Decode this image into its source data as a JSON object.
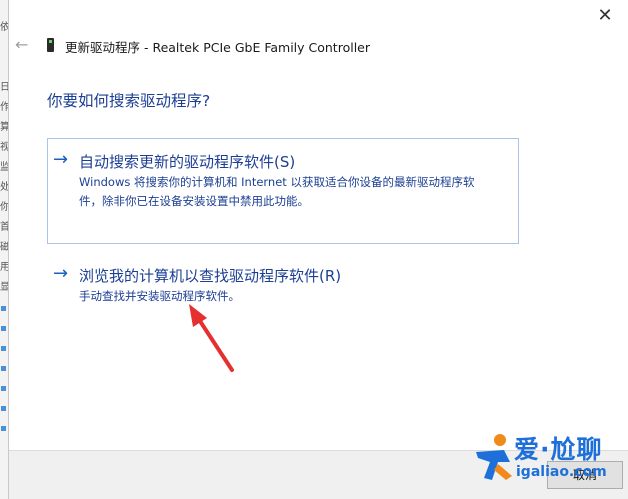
{
  "dialog": {
    "title": "更新驱动程序 - Realtek PCIe GbE Family Controller",
    "question": "你要如何搜索驱动程序?",
    "close_glyph": "✕",
    "back_glyph": "←"
  },
  "options": [
    {
      "arrow": "→",
      "title": "自动搜索更新的驱动程序软件(S)",
      "desc_line1": "Windows 将搜索你的计算机和 Internet 以获取适合你设备的最新驱动程序软",
      "desc_line2": "件，除非你已在设备安装设置中禁用此功能。"
    },
    {
      "arrow": "→",
      "title": "浏览我的计算机以查找驱动程序软件(R)",
      "desc_line1": "手动查找并安装驱动程序软件。"
    }
  ],
  "footer": {
    "cancel_label": "取消"
  },
  "background_window": {
    "chars": [
      "依",
      "日",
      "作",
      "算",
      "视",
      "监",
      "处",
      "你",
      "首",
      "磁",
      "用",
      "显"
    ]
  },
  "watermark": {
    "text_main": "爱·尬聊",
    "text_sub": "igaliao.com"
  },
  "colors": {
    "link_blue": "#1c3f94",
    "arrow_blue": "#1c5fbf",
    "annotation_red": "#e53030",
    "border_blue": "#a9c4e8"
  }
}
